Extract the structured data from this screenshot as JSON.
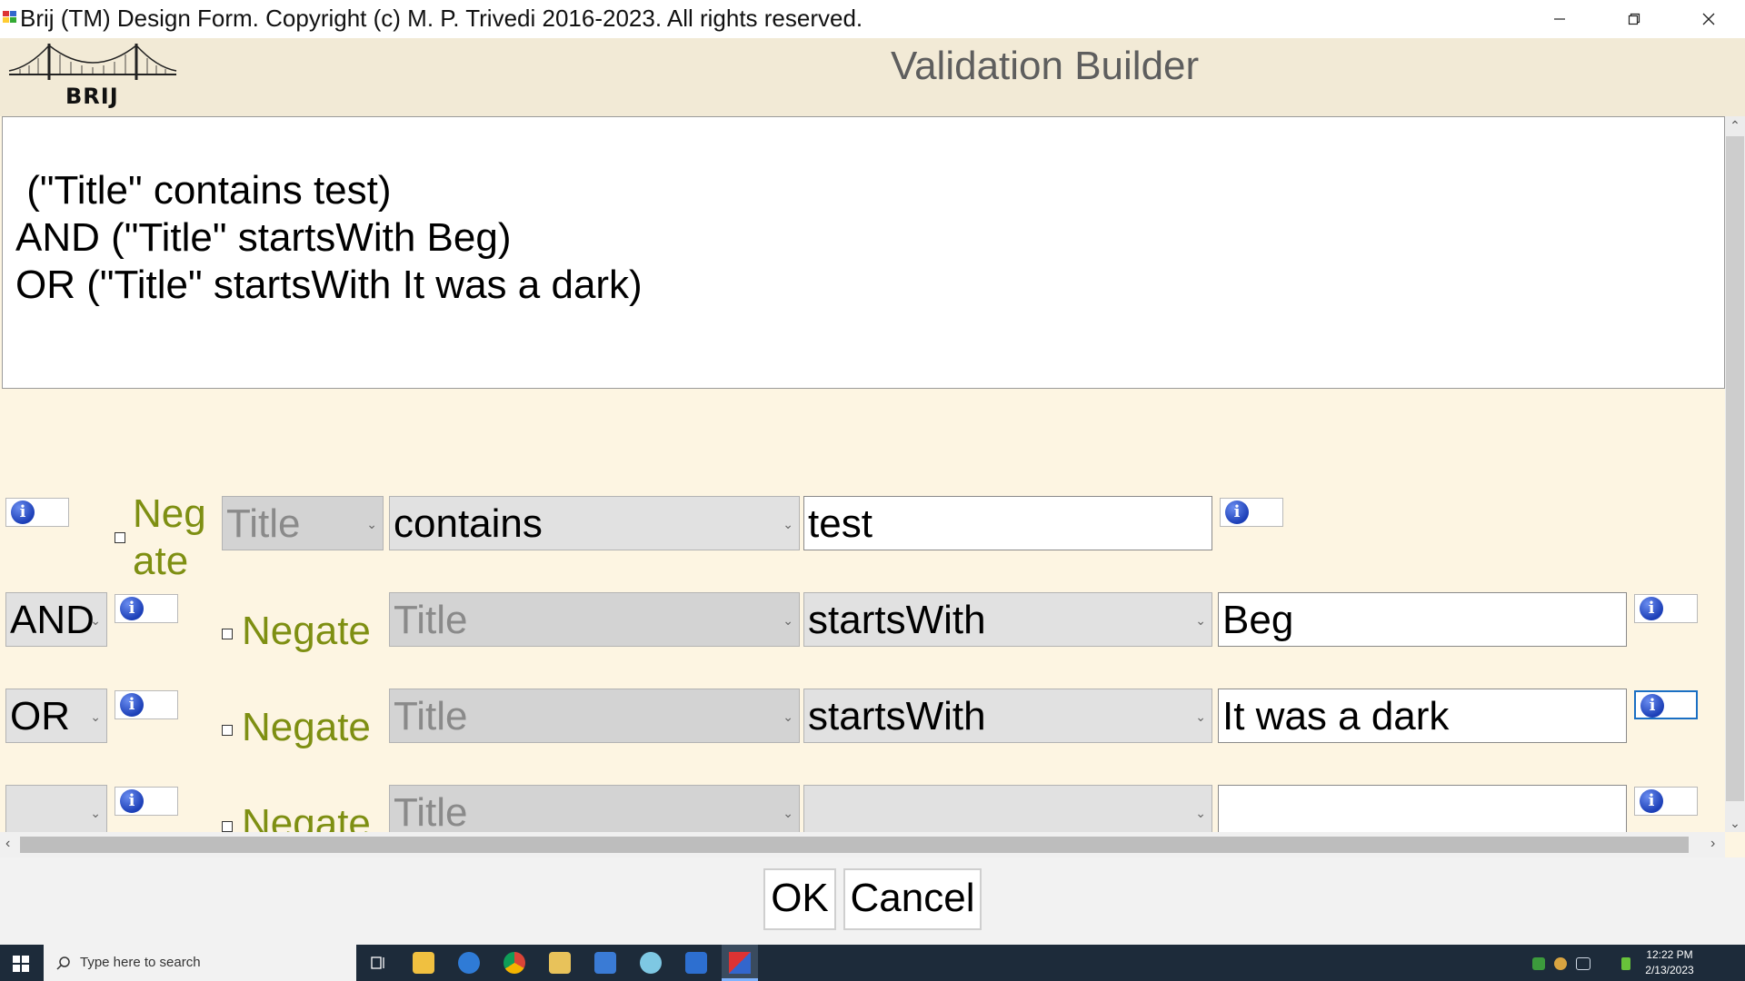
{
  "window": {
    "title": "Brij (TM) Design Form. Copyright (c) M. P. Trivedi 2016-2023.  All rights reserved.",
    "minimize_icon": "minimize-icon",
    "restore_icon": "restore-icon",
    "close_icon": "close-icon"
  },
  "header": {
    "logo_text": "BRIJ",
    "form_title": "Validation Builder"
  },
  "expression": {
    "lines": [
      " (\"Title\" contains test)",
      "AND (\"Title\" startsWith Beg)",
      "OR (\"Title\" startsWith It was a dark)"
    ]
  },
  "rows": [
    {
      "connector": "",
      "negate_label": "Neg\nate",
      "field": "Title",
      "operator": "contains",
      "value": "test"
    },
    {
      "connector": "AND",
      "negate_label": "Negate",
      "field": "Title",
      "operator": "startsWith",
      "value": "Beg"
    },
    {
      "connector": "OR",
      "negate_label": "Negate",
      "field": "Title",
      "operator": "startsWith",
      "value": "It was a dark"
    },
    {
      "connector": "",
      "negate_label": "Negate",
      "field": "Title",
      "operator": "",
      "value": ""
    }
  ],
  "buttons": {
    "ok": "OK",
    "cancel": "Cancel"
  },
  "taskbar": {
    "search_placeholder": "Type here to search",
    "time": "12:22 PM",
    "date": "2/13/2023"
  },
  "colors": {
    "form_background": "#fdf5e2",
    "header_background": "#f2ead6",
    "negate_text": "#7e8f12",
    "title_text": "#5e5e5e",
    "taskbar": "#1d2b3a"
  }
}
